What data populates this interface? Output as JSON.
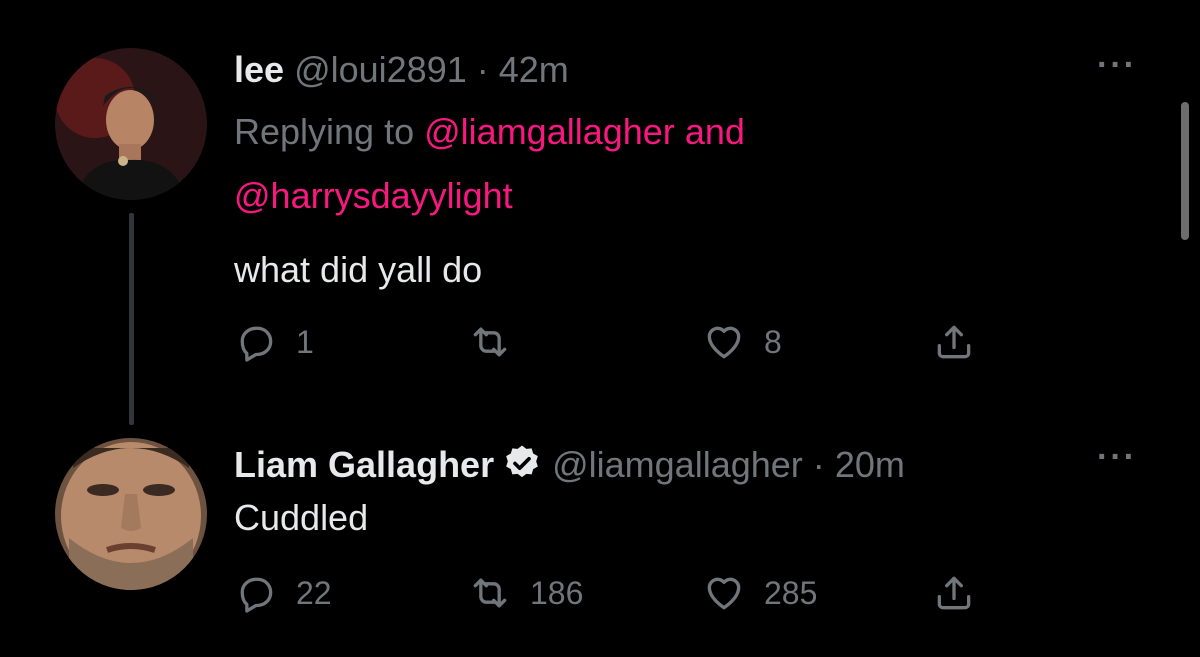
{
  "tweets": [
    {
      "display_name": "lee",
      "handle": "@loui2891",
      "separator": "·",
      "time": "42m",
      "replying_prefix": "Replying to",
      "reply_handle_1": "@liamgallagher",
      "reply_joiner": "and",
      "reply_handle_2": "@harrysdayylight",
      "text": "what did yall do",
      "replies": "1",
      "retweets": "",
      "likes": "8"
    },
    {
      "display_name": "Liam Gallagher",
      "handle": "@liamgallagher",
      "separator": "·",
      "time": "20m",
      "text": "Cuddled",
      "replies": "22",
      "retweets": "186",
      "likes": "285"
    }
  ],
  "more_glyph": "···",
  "colors": {
    "background": "#000000",
    "text": "#e7e9ea",
    "muted": "#71767b",
    "mention": "#f91880"
  }
}
